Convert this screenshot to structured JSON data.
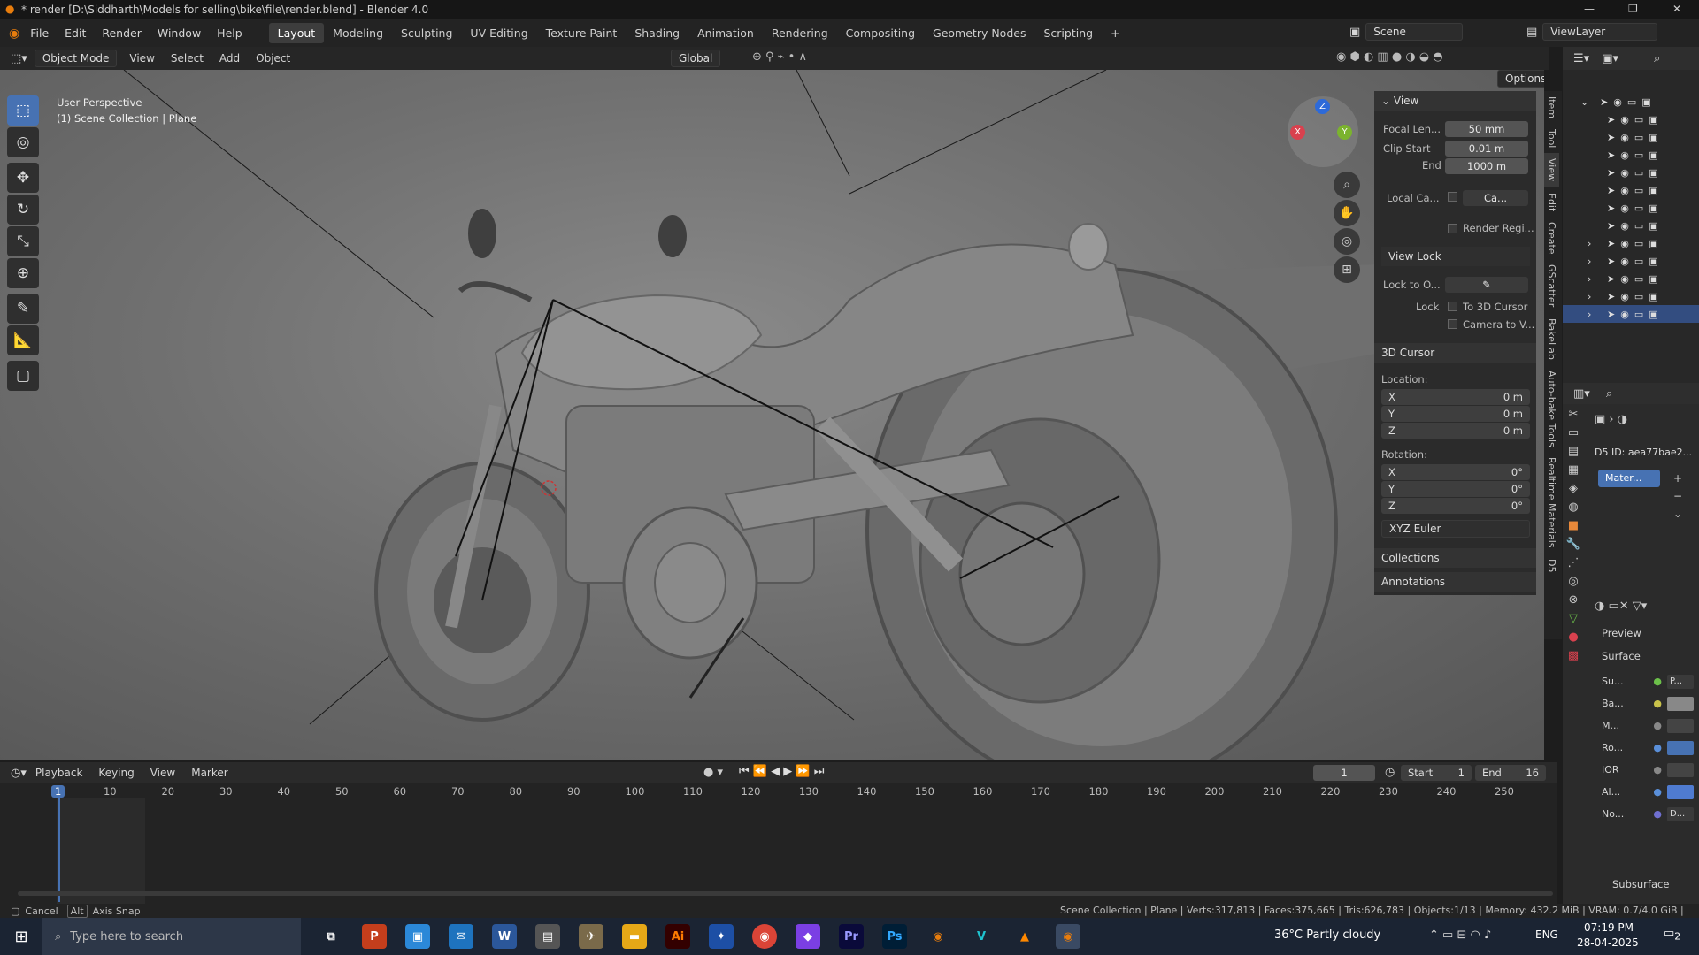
{
  "window": {
    "title": "* render [D:\\Siddharth\\Models for selling\\bike\\file\\render.blend] - Blender 4.0",
    "minimize": "—",
    "maximize": "❐",
    "close": "✕"
  },
  "menu": [
    "File",
    "Edit",
    "Render",
    "Window",
    "Help"
  ],
  "workspaces": [
    "Layout",
    "Modeling",
    "Sculpting",
    "UV Editing",
    "Texture Paint",
    "Shading",
    "Animation",
    "Rendering",
    "Compositing",
    "Geometry Nodes",
    "Scripting",
    "+"
  ],
  "scene": {
    "label": "Scene",
    "view_layer": "ViewLayer"
  },
  "viewport_header": {
    "mode": "Object Mode",
    "items": [
      "View",
      "Select",
      "Add",
      "Object"
    ],
    "transform": "Global",
    "options": "Options"
  },
  "viewport": {
    "perspective": "User Perspective",
    "collection": "(1) Scene Collection | Plane"
  },
  "gizmo": {
    "x": "X",
    "y": "Y",
    "z": "Z"
  },
  "npanel": {
    "view_title": "View",
    "focal_label": "Focal Len...",
    "focal_value": "50 mm",
    "clip_start_label": "Clip Start",
    "clip_start_value": "0.01 m",
    "clip_end_label": "End",
    "clip_end_value": "1000 m",
    "local_cam_label": "Local Ca...",
    "local_cam_value": "Ca...",
    "render_region": "Render Regi...",
    "view_lock": "View Lock",
    "lock_to_label": "Lock to O...",
    "lock_label": "Lock",
    "to_3d_cursor": "To 3D Cursor",
    "camera_to_view": "Camera to V...",
    "cursor_title": "3D Cursor",
    "location_label": "Location:",
    "loc": [
      {
        "axis": "X",
        "value": "0 m"
      },
      {
        "axis": "Y",
        "value": "0 m"
      },
      {
        "axis": "Z",
        "value": "0 m"
      }
    ],
    "rotation_label": "Rotation:",
    "rot": [
      {
        "axis": "X",
        "value": "0°"
      },
      {
        "axis": "Y",
        "value": "0°"
      },
      {
        "axis": "Z",
        "value": "0°"
      }
    ],
    "rotation_mode": "XYZ Euler",
    "collections": "Collections",
    "annotations": "Annotations"
  },
  "side_tabs": [
    "Item",
    "Tool",
    "View",
    "Edit",
    "Create",
    "GScatter",
    "BakeLab",
    "Auto-bake Tools",
    "Realtime Materials",
    "D5"
  ],
  "props": {
    "d5_id": "D5 ID: aea77bae2...",
    "material": "Mater...",
    "preview": "Preview",
    "surface": "Surface",
    "rows": [
      {
        "label": "Su...",
        "value": "P..."
      },
      {
        "label": "Ba...",
        "value": ""
      },
      {
        "label": "M...",
        "value": ""
      },
      {
        "label": "Ro...",
        "value": ""
      },
      {
        "label": "IOR",
        "value": ""
      },
      {
        "label": "Al...",
        "value": ""
      },
      {
        "label": "No...",
        "value": "D..."
      }
    ],
    "subsurface": "Subsurface"
  },
  "timeline": {
    "menus": [
      "Playback",
      "Keying",
      "View",
      "Marker"
    ],
    "current_frame": "1",
    "start_label": "Start",
    "start_value": "1",
    "end_label": "End",
    "end_value": "16",
    "ticks": [
      "1",
      "10",
      "20",
      "30",
      "40",
      "50",
      "60",
      "70",
      "80",
      "90",
      "100",
      "110",
      "120",
      "130",
      "140",
      "150",
      "160",
      "170",
      "180",
      "190",
      "200",
      "210",
      "220",
      "230",
      "240",
      "250"
    ]
  },
  "status": {
    "cancel": "Cancel",
    "alt": "Alt",
    "axis_snap": "Axis Snap",
    "stats": "Scene Collection | Plane | Verts:317,813 | Faces:375,665 | Tris:626,783 | Objects:1/13 | Memory: 432.2 MiB | VRAM: 0.7/4.0 GiB | 4.0.2"
  },
  "taskbar": {
    "search_placeholder": "Type here to search",
    "weather": "36°C  Partly cloudy",
    "lang": "ENG",
    "time": "07:19 PM",
    "date": "28-04-2025",
    "notifications": "2"
  }
}
